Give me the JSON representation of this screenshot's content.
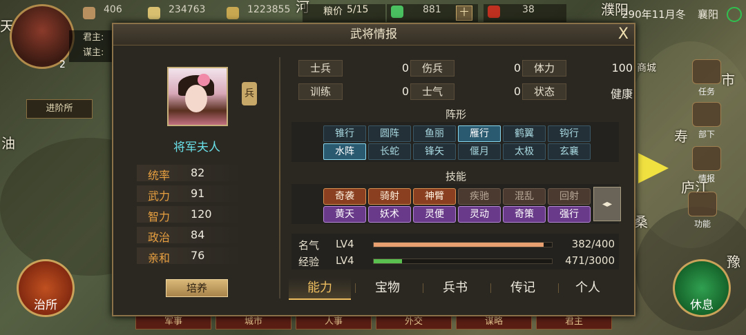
{
  "hud": {
    "resources": [
      {
        "icon": "grain-sack-icon",
        "value": "406"
      },
      {
        "icon": "coin-icon",
        "value": "234763"
      },
      {
        "icon": "food-icon",
        "value": "1223855"
      }
    ],
    "grain_price_label": "粮价",
    "grain_price_value": "5/15",
    "jade_value": "881",
    "plus_label": "十",
    "token_value": "38",
    "date": "290年11月冬",
    "city": "襄阳",
    "lord_label": "君主:",
    "strategist_label": "谋主:",
    "avatar_badge": "2",
    "promote_label": "进阶所",
    "govern_label": "治所",
    "rest_label": "休息"
  },
  "map_labels": [
    "河",
    "濮阳",
    "天",
    "油",
    "寿",
    "庐江",
    "桑",
    "豫",
    "市",
    "商城"
  ],
  "side_buttons": [
    {
      "icon": "mission-icon",
      "label": "任务"
    },
    {
      "icon": "subordinate-icon",
      "label": "部下"
    },
    {
      "icon": "intel-icon",
      "label": "情报"
    },
    {
      "icon": "function-icon",
      "label": "功能"
    }
  ],
  "bottom_nav": [
    "军事",
    "城市",
    "人事",
    "外交",
    "谋略",
    "君主"
  ],
  "dialog": {
    "title": "武将情报",
    "close": "X",
    "general_name": "将军夫人",
    "troop_type": "兵",
    "stats": [
      {
        "label": "统率",
        "value": "82"
      },
      {
        "label": "武力",
        "value": "91"
      },
      {
        "label": "智力",
        "value": "120"
      },
      {
        "label": "政治",
        "value": "84"
      },
      {
        "label": "亲和",
        "value": "76"
      }
    ],
    "train_button": "培养",
    "attributes": [
      {
        "label": "士兵",
        "value": "0"
      },
      {
        "label": "伤兵",
        "value": "0"
      },
      {
        "label": "体力",
        "value": "100"
      },
      {
        "label": "训练",
        "value": "0"
      },
      {
        "label": "士气",
        "value": "0"
      },
      {
        "label": "状态",
        "value": "健康"
      }
    ],
    "formation_title": "阵形",
    "formations": [
      "锥行",
      "圆阵",
      "鱼丽",
      "雁行",
      "鹤翼",
      "钩行",
      "水阵",
      "长蛇",
      "锋矢",
      "偃月",
      "太极",
      "玄襄"
    ],
    "skills_title": "技能",
    "skills": [
      "奇袭",
      "骑射",
      "神臂",
      "疾驰",
      "混乱",
      "回射",
      "黄天",
      "妖术",
      "灵便",
      "灵动",
      "奇策",
      "强行"
    ],
    "fame": {
      "label": "名气",
      "level": "LV4",
      "value": "382/400",
      "ratio": 0.955
    },
    "exp": {
      "label": "经验",
      "level": "LV4",
      "value": "471/3000",
      "ratio": 0.157
    },
    "tabs": [
      "能力",
      "宝物",
      "兵书",
      "传记",
      "个人"
    ]
  }
}
